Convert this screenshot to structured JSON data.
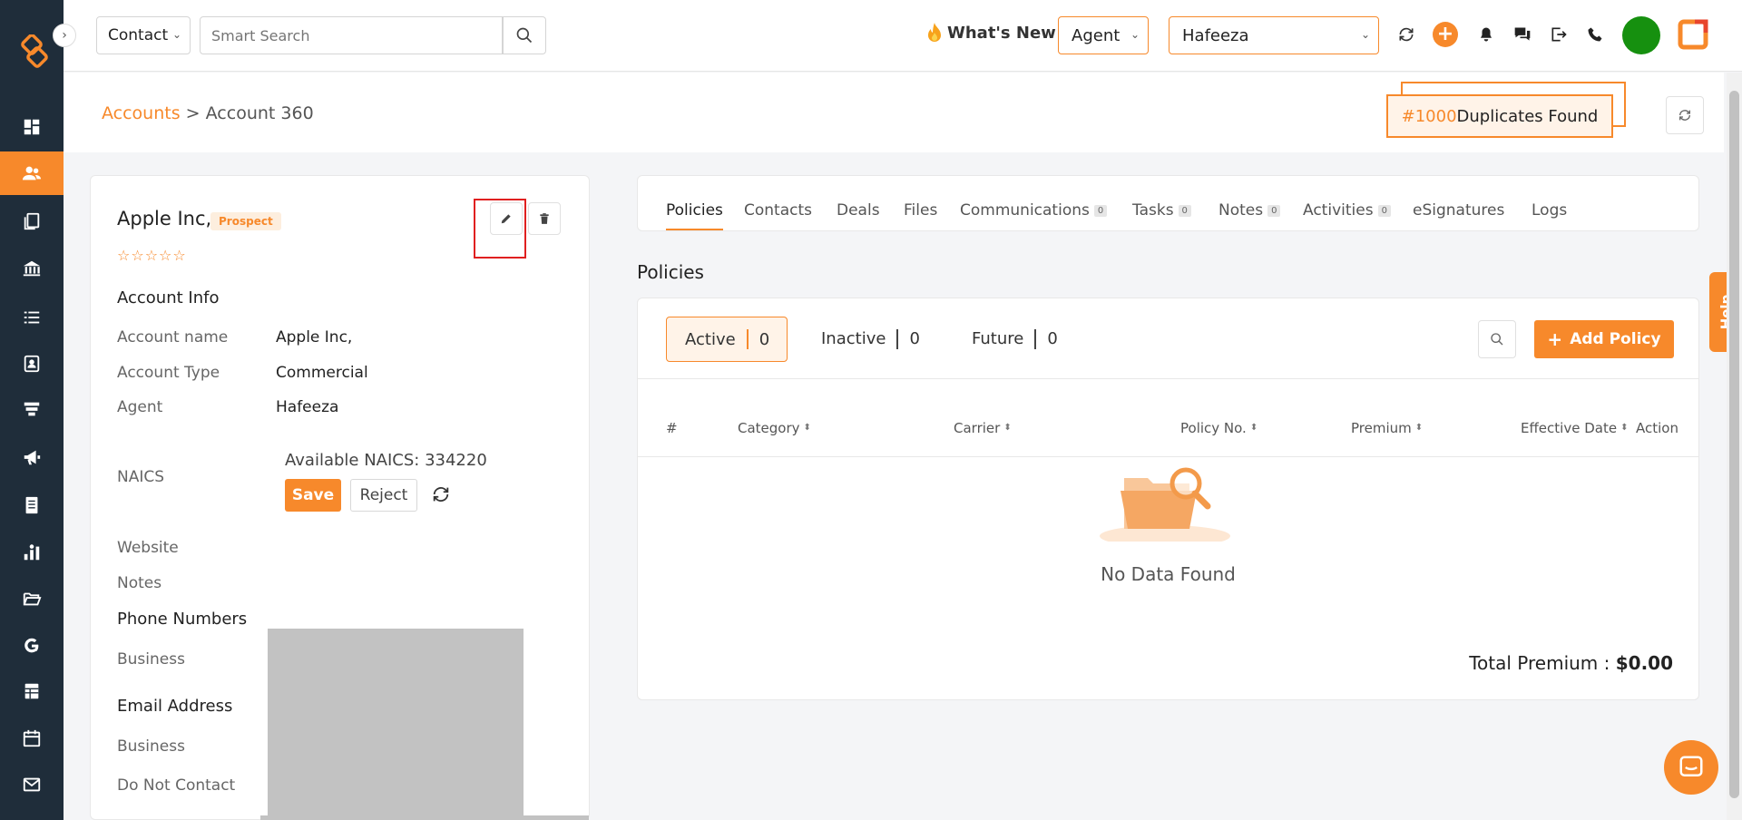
{
  "topbar": {
    "scope": "Contact",
    "search_placeholder": "Smart Search",
    "whats_new": "What's New",
    "role": "Agent",
    "user": "Hafeeza"
  },
  "header": {
    "breadcrumb_root": "Accounts",
    "breadcrumb_sep": ">",
    "breadcrumb_current": "Account 360",
    "dup_number": "#1000",
    "dup_text": "Duplicates Found"
  },
  "account": {
    "name": "Apple Inc,",
    "status": "Prospect",
    "stars": "☆☆☆☆☆",
    "rating": 0,
    "info_title": "Account Info",
    "fields": [
      {
        "label": "Account name",
        "value": "Apple Inc,"
      },
      {
        "label": "Account Type",
        "value": "Commercial"
      },
      {
        "label": "Agent",
        "value": "Hafeeza"
      }
    ],
    "naics_label": "NAICS",
    "naics_available": "Available NAICS: 334220",
    "save": "Save",
    "reject": "Reject",
    "website_label": "Website",
    "notes_label": "Notes",
    "phone_title": "Phone Numbers",
    "phone_business": "Business",
    "email_title": "Email Address",
    "email_business": "Business",
    "dnc_label": "Do Not Contact"
  },
  "tabs": [
    {
      "label": "Policies",
      "badge": ""
    },
    {
      "label": "Contacts",
      "badge": ""
    },
    {
      "label": "Deals",
      "badge": ""
    },
    {
      "label": "Files",
      "badge": ""
    },
    {
      "label": "Communications",
      "badge": "0"
    },
    {
      "label": "Tasks",
      "badge": "0"
    },
    {
      "label": "Notes",
      "badge": "0"
    },
    {
      "label": "Activities",
      "badge": "0"
    },
    {
      "label": "eSignatures",
      "badge": ""
    },
    {
      "label": "Logs",
      "badge": ""
    }
  ],
  "policies": {
    "title": "Policies",
    "filters": [
      {
        "label": "Active",
        "count": "0"
      },
      {
        "label": "Inactive",
        "count": "0"
      },
      {
        "label": "Future",
        "count": "0"
      }
    ],
    "add_label": "Add Policy",
    "columns": [
      "#",
      "Category",
      "Carrier",
      "Policy No.",
      "Premium",
      "Effective Date",
      "Action"
    ],
    "empty": "No Data Found",
    "total_label": "Total Premium :",
    "total_value": "$0.00"
  },
  "help": "Help",
  "colors": {
    "accent": "#f7892b",
    "sidebar": "#1f2d3a",
    "avatar": "#16900f",
    "highlight": "#e02020"
  }
}
